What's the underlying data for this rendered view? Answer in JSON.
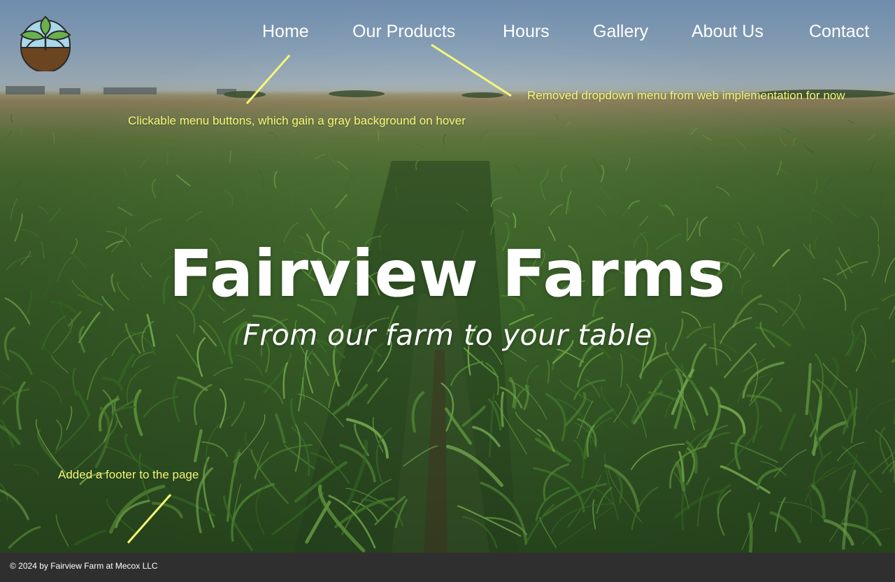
{
  "brand": {
    "logo_icon": "farm-sprout-logo-icon",
    "colors": {
      "sky": "#8eb4df",
      "leaf": "#5a9a3a",
      "soil": "#6b4520",
      "accent_note": "#f4f877",
      "footer_bg": "#2f2f2f"
    }
  },
  "nav": {
    "items": [
      {
        "label": "Home"
      },
      {
        "label": "Our Products"
      },
      {
        "label": "Hours"
      },
      {
        "label": "Gallery"
      },
      {
        "label": "About Us"
      },
      {
        "label": "Contact"
      }
    ]
  },
  "hero": {
    "title": "Fairview Farms",
    "subtitle": "From our farm to your table"
  },
  "annotations": {
    "menu_buttons": "Clickable menu buttons, which gain a gray background on hover",
    "dropdown": "Removed dropdown menu from web implementation for now",
    "footer": "Added a footer to the page"
  },
  "footer": {
    "copyright": "© 2024 by Fairview Farm at Mecox LLC"
  }
}
